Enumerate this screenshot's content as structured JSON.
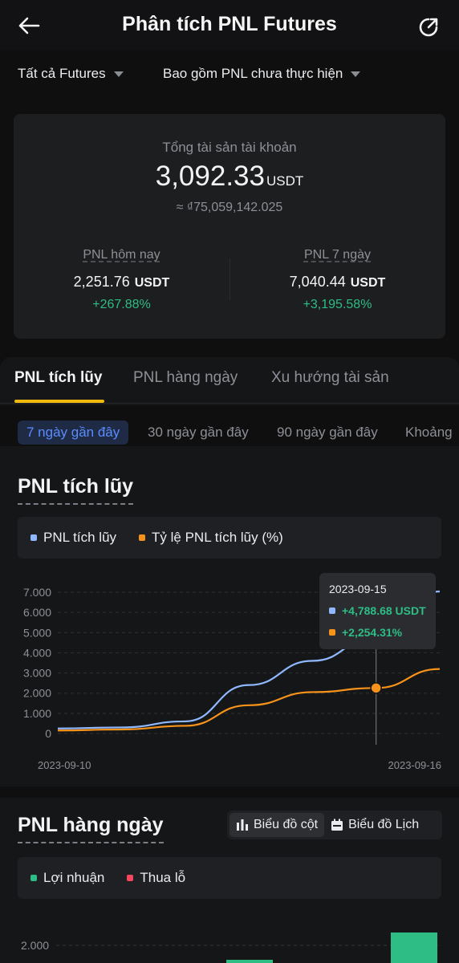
{
  "header": {
    "title": "Phân tích PNL Futures",
    "back_icon": "arrow-left-icon",
    "share_icon": "share-icon"
  },
  "filters": {
    "market": "Tất cả Futures",
    "pnl_mode": "Bao gồm PNL chưa thực hiện"
  },
  "summary": {
    "total_label": "Tổng tài sản tài khoản",
    "total_value": "3,092.33",
    "total_unit": "USDT",
    "total_fiat": "≈ ₫75,059,142.025",
    "today": {
      "label": "PNL hôm nay",
      "value": "2,251.76",
      "unit": "USDT",
      "pct": "+267.88%"
    },
    "week": {
      "label": "PNL 7 ngày",
      "value": "7,040.44",
      "unit": "USDT",
      "pct": "+3,195.58%"
    }
  },
  "tabs": [
    {
      "label": "PNL tích lũy",
      "active": true
    },
    {
      "label": "PNL hàng ngày",
      "active": false
    },
    {
      "label": "Xu hướng tài sản",
      "active": false
    }
  ],
  "ranges": [
    {
      "label": "7 ngày gần đây",
      "active": true
    },
    {
      "label": "30 ngày gần đây",
      "active": false
    },
    {
      "label": "90 ngày gần đây",
      "active": false
    },
    {
      "label": "Khoảng",
      "active": false
    }
  ],
  "cumulative": {
    "title": "PNL tích lũy",
    "legend": [
      "PNL tích lũy",
      "Tỷ lệ PNL tích lũy (%)"
    ],
    "tooltip": {
      "date": "2023-09-15",
      "pnl": "+4,788.68 USDT",
      "rate": "+2,254.31%"
    }
  },
  "daily": {
    "title": "PNL hàng ngày",
    "toggle": [
      {
        "label": "Biểu đồ cột",
        "icon": "bar-chart-icon",
        "active": true
      },
      {
        "label": "Biểu đồ Lịch",
        "icon": "calendar-icon",
        "active": false
      }
    ],
    "legend": [
      "Lợi nhuận",
      "Thua lỗ"
    ],
    "ytick": "2.000"
  },
  "colors": {
    "accent": "#f0b90b",
    "pnl_series": "#8fb8ff",
    "rate_series": "#f7931a",
    "profit": "#2ebd85",
    "loss": "#f6465d"
  },
  "chart_data": [
    {
      "type": "line",
      "x_start": "2023-09-10",
      "x_end": "2023-09-16",
      "yticks": [
        "0",
        "1.000",
        "2.000",
        "3.000",
        "4.000",
        "5.000",
        "6.000",
        "7.000"
      ],
      "ylim": [
        0,
        7000
      ],
      "series": [
        {
          "name": "PNL tích lũy",
          "x": [
            "2023-09-10",
            "2023-09-11",
            "2023-09-12",
            "2023-09-13",
            "2023-09-14",
            "2023-09-15",
            "2023-09-16"
          ],
          "values": [
            250,
            300,
            600,
            2400,
            3600,
            4789,
            7040
          ]
        },
        {
          "name": "Tỷ lệ PNL tích lũy (%)",
          "x": [
            "2023-09-10",
            "2023-09-11",
            "2023-09-12",
            "2023-09-13",
            "2023-09-14",
            "2023-09-15",
            "2023-09-16"
          ],
          "values": [
            150,
            200,
            380,
            1400,
            2050,
            2254,
            3196
          ]
        }
      ],
      "highlight_x": "2023-09-15"
    },
    {
      "type": "bar",
      "yticks": [
        "2.000"
      ],
      "series": [
        {
          "name": "Lợi nhuận",
          "values": []
        },
        {
          "name": "Thua lỗ",
          "values": []
        }
      ]
    }
  ]
}
